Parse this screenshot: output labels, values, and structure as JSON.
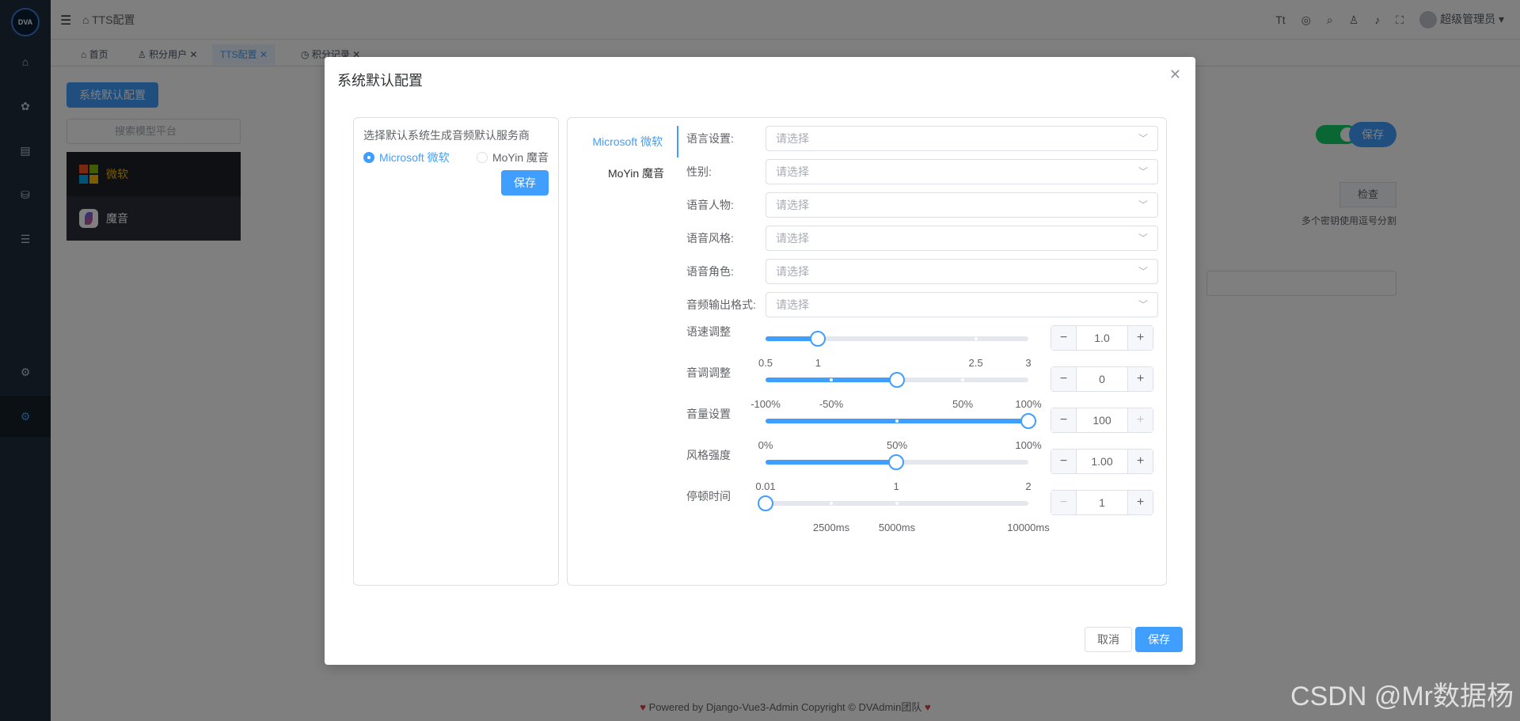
{
  "app": {
    "logo_text": "DVA",
    "breadcrumb": "TTS配置",
    "user": "超级管理员",
    "tabs": [
      {
        "label": "首页",
        "closable": false
      },
      {
        "label": "积分用户",
        "closable": true
      },
      {
        "label": "TTS配置",
        "closable": true,
        "active": true
      },
      {
        "label": "积分记录",
        "closable": true
      }
    ],
    "sidebar_icons": [
      "home-icon",
      "settings-icon",
      "document-icon",
      "database-icon",
      "list-icon",
      "gear-icon",
      "gear-active-icon"
    ]
  },
  "background": {
    "primary_button": "系统默认配置",
    "search_placeholder": "搜索模型平台",
    "platforms": [
      "微软",
      "魔音"
    ],
    "save_label": "保存",
    "check_label": "检查",
    "key_hint": "多个密钥使用逗号分割"
  },
  "dialog": {
    "title": "系统默认配置",
    "left": {
      "label": "选择默认系统生成音频默认服务商",
      "options": [
        "Microsoft 微软",
        "MoYin 魔音"
      ],
      "selected": "Microsoft 微软",
      "save": "保存"
    },
    "tabs": [
      "Microsoft 微软",
      "MoYin 魔音"
    ],
    "active_tab": "Microsoft 微软",
    "selects": [
      {
        "label": "语言设置:",
        "placeholder": "请选择"
      },
      {
        "label": "性别:",
        "placeholder": "请选择"
      },
      {
        "label": "语音人物:",
        "placeholder": "请选择"
      },
      {
        "label": "语音风格:",
        "placeholder": "请选择"
      },
      {
        "label": "语音角色:",
        "placeholder": "请选择"
      },
      {
        "label": "音频输出格式:",
        "placeholder": "请选择"
      }
    ],
    "sliders": [
      {
        "label": "语速调整",
        "min": 0.5,
        "max": 3,
        "value": 1.0,
        "display": "1.0",
        "marks": [
          {
            "v": 0.5,
            "t": "0.5"
          },
          {
            "v": 1,
            "t": "1"
          },
          {
            "v": 2.5,
            "t": "2.5"
          },
          {
            "v": 3,
            "t": "3"
          }
        ],
        "minus_disabled": false,
        "plus_disabled": false
      },
      {
        "label": "音调调整",
        "min": -100,
        "max": 100,
        "value": 0,
        "display": "0",
        "marks": [
          {
            "v": -100,
            "t": "-100%"
          },
          {
            "v": -50,
            "t": "-50%"
          },
          {
            "v": 50,
            "t": "50%"
          },
          {
            "v": 100,
            "t": "100%"
          }
        ],
        "minus_disabled": false,
        "plus_disabled": false
      },
      {
        "label": "音量设置",
        "min": 0,
        "max": 100,
        "value": 100,
        "display": "100",
        "marks": [
          {
            "v": 0,
            "t": "0%"
          },
          {
            "v": 50,
            "t": "50%"
          },
          {
            "v": 100,
            "t": "100%"
          }
        ],
        "minus_disabled": false,
        "plus_disabled": true
      },
      {
        "label": "风格强度",
        "min": 0.01,
        "max": 2,
        "value": 1.0,
        "display": "1.00",
        "marks": [
          {
            "v": 0.01,
            "t": "0.01"
          },
          {
            "v": 1,
            "t": "1"
          },
          {
            "v": 2,
            "t": "2"
          }
        ],
        "minus_disabled": false,
        "plus_disabled": false
      },
      {
        "label": "停顿时间",
        "min": 1,
        "max": 10000,
        "value": 1,
        "display": "1",
        "marks": [
          {
            "v": 2500,
            "t": "2500ms"
          },
          {
            "v": 5000,
            "t": "5000ms"
          },
          {
            "v": 10000,
            "t": "10000ms"
          }
        ],
        "minus_disabled": true,
        "plus_disabled": false
      }
    ],
    "cancel": "取消",
    "save": "保存"
  },
  "footer": "Powered by Django-Vue3-Admin Copyright © DVAdmin团队",
  "watermark": "CSDN @Mr数据杨",
  "colors": {
    "primary": "#409eff",
    "sidebar": "#1f2d3d",
    "toggle_on": "#13ce66"
  }
}
